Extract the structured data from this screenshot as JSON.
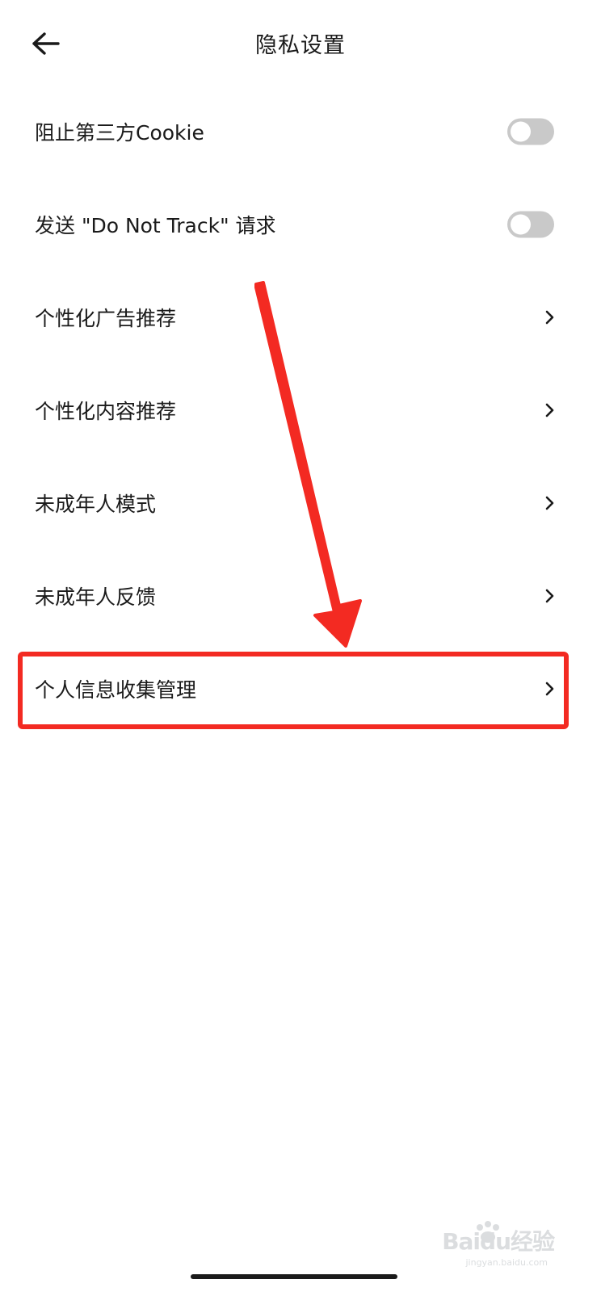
{
  "header": {
    "title": "隐私设置",
    "back_icon": "arrow-left-icon"
  },
  "settings": [
    {
      "label": "阻止第三方Cookie",
      "control": "toggle",
      "on": false
    },
    {
      "label": "发送 \"Do Not Track\" 请求",
      "control": "toggle",
      "on": false
    },
    {
      "label": "个性化广告推荐",
      "control": "chevron"
    },
    {
      "label": "个性化内容推荐",
      "control": "chevron"
    },
    {
      "label": "未成年人模式",
      "control": "chevron"
    },
    {
      "label": "未成年人反馈",
      "control": "chevron"
    },
    {
      "label": "个人信息收集管理",
      "control": "chevron",
      "highlighted": true
    }
  ],
  "annotation": {
    "color": "#f32a22"
  },
  "watermark": {
    "text": "Baidu经验",
    "sub": "jingyan.baidu.com"
  },
  "colors": {
    "toggle_off": "#c9c9c9",
    "text": "#1a1a1a",
    "annotation_red": "#f32a22"
  }
}
